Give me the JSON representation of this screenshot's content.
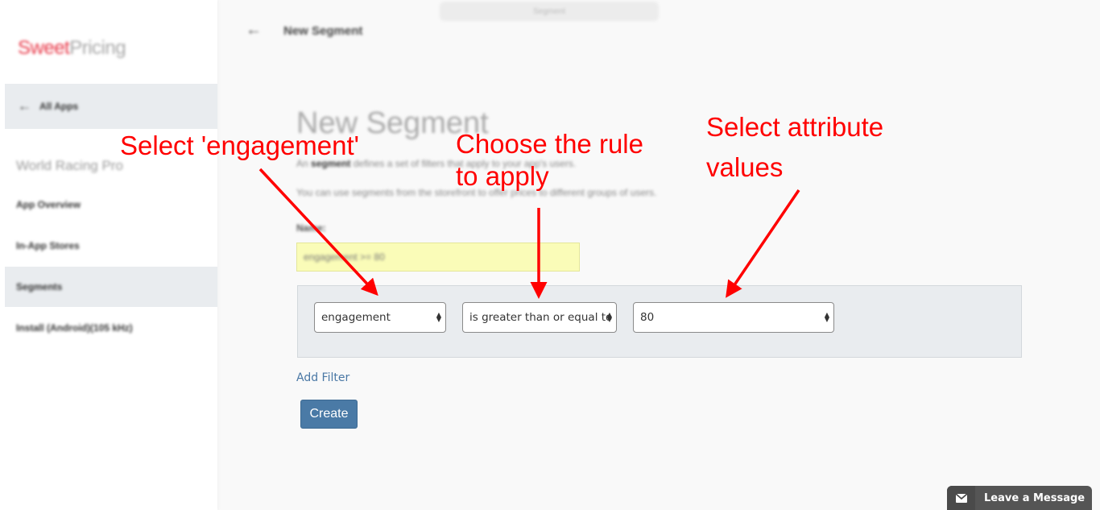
{
  "top_bar": {
    "pill_text": "Segment"
  },
  "sidebar": {
    "logo_part1": "Sweet",
    "logo_part2": "Pricing",
    "all_apps_label": "All Apps",
    "app_name": "World Racing Pro",
    "items": [
      {
        "label": "App Overview",
        "active": false
      },
      {
        "label": "In-App Stores",
        "active": false
      },
      {
        "label": "Segments",
        "active": true
      },
      {
        "label": "Install (Android)(105 kHz)",
        "active": false
      }
    ]
  },
  "header": {
    "title": "New Segment"
  },
  "main": {
    "page_title": "New Segment",
    "description_prefix": "An",
    "description_bold": "segment",
    "description_suffix": "defines a set of filters that apply to your app's users.",
    "description_2": "You can use segments from the storefront to offer prices to different groups of users.",
    "name_label": "Name:",
    "name_value": "engagement >= 80",
    "filter": {
      "attribute": "engagement",
      "rule": "is greater than or equal to",
      "value": "80"
    },
    "add_filter_label": "Add Filter",
    "create_label": "Create"
  },
  "annotations": {
    "select_attribute": "Select 'engagement'",
    "choose_rule_line1": "Choose the rule",
    "choose_rule_line2": "to apply",
    "select_values_line1": "Select attribute",
    "select_values_line2": "values",
    "color": "#ff0000"
  },
  "chat_widget": {
    "label": "Leave a Message"
  }
}
